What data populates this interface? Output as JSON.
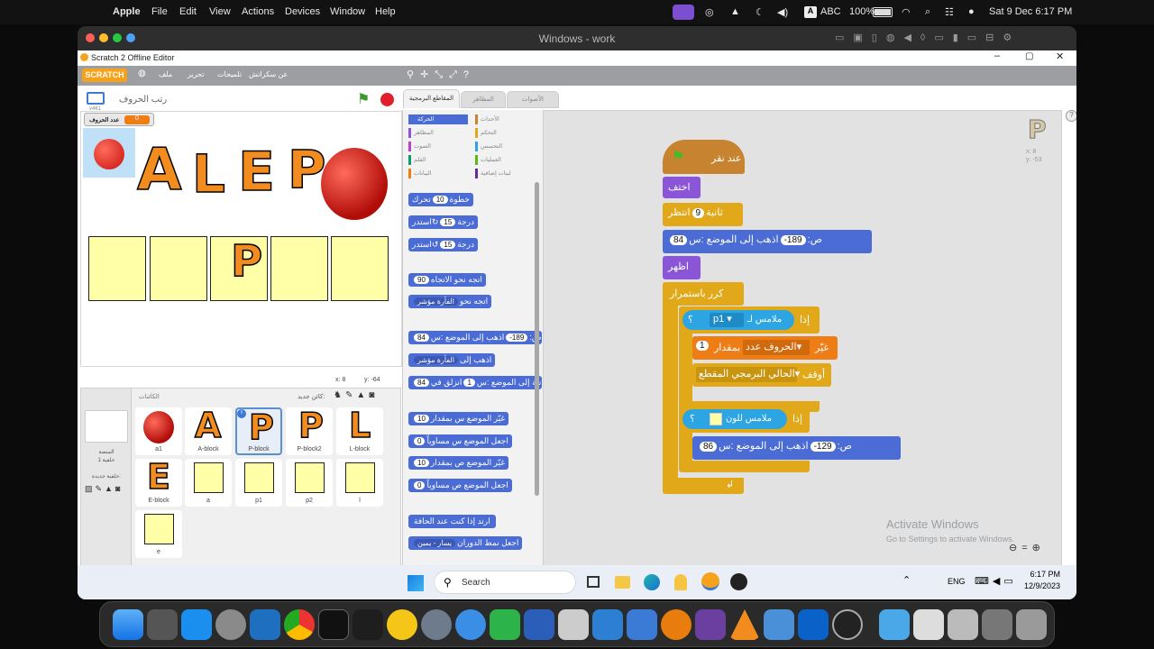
{
  "mac": {
    "app": "Apple",
    "menus": [
      "File",
      "Edit",
      "View",
      "Actions",
      "Devices",
      "Window",
      "Help"
    ],
    "kbd": "ABC",
    "battery": "100%",
    "datetime": "Sat 9 Dec  6:17 PM"
  },
  "vm": {
    "title": "Windows - work"
  },
  "scratch": {
    "title": "Scratch 2 Offline Editor",
    "logo": "SCRATCH",
    "menus": [
      "ملف",
      "تحرير",
      "تلميحات",
      "عن سكراتش"
    ],
    "stage": {
      "title": "رتب الحروف",
      "size": "v461",
      "var_label": "عدد الحروف",
      "var_value": "0",
      "coords_x": "x: 8",
      "coords_y": "y: -64",
      "letters": [
        "A",
        "L",
        "E",
        "P"
      ],
      "slot_letter": "P"
    },
    "tabs": [
      "المقاطع البرمجية",
      "المظاهر",
      "الأصوات"
    ],
    "categories_left": [
      "الحركة",
      "المظاهر",
      "الصوت",
      "القلم",
      "البيانات"
    ],
    "categories_right": [
      "الأحداث",
      "التحكم",
      "التحسس",
      "العمليات",
      "لبنات إضافية"
    ],
    "palette": [
      {
        "text": "تحرك",
        "val": "10",
        "text2": "خطوة"
      },
      {
        "text": "استدر",
        "val": "15",
        "text2": "درجة"
      },
      {
        "text": "استدر",
        "val": "15",
        "text2": "درجة"
      },
      {
        "text": "اتجه نحو الاتجاه",
        "val": "90"
      },
      {
        "text": "اتجه نحو",
        "text2": "الفأرة مؤشر"
      },
      {
        "text": "اذهب إلى الموضع :س",
        "val": "-189",
        "text2": "ص:",
        "val2": "84"
      },
      {
        "text": "اذهب إلى",
        "text2": "الفأرة مؤشر"
      },
      {
        "text": "انزلق في",
        "val": "1",
        "text2": "ثانية إلى الموضع :س",
        "val2": "84"
      },
      {
        "text": "غيّر الموضع س بمقدار",
        "val": "10"
      },
      {
        "text": "اجعل الموضع س مساوياً",
        "val": "0"
      },
      {
        "text": "غيّر الموضع ص بمقدار",
        "val": "10"
      },
      {
        "text": "اجعل الموضع ص مساوياً",
        "val": "0"
      },
      {
        "text": "ارتد إذا كنت عند الحافة"
      },
      {
        "text": "اجعل نمط الدوران",
        "text2": "يسار - يمين"
      }
    ],
    "sprites_label": "الكائنات",
    "new_sprite": "كائن جديد:",
    "stage_label": "المنصة",
    "stage_bg": "خلفية 1",
    "new_bg": "خلفية جديدة:",
    "sprite_names": [
      "a1",
      "A-block",
      "P-block",
      "P-block2",
      "L-block",
      "E-block",
      "a",
      "p1",
      "p2",
      "l",
      "e"
    ],
    "sprite_letters": [
      "",
      "A",
      "P",
      "P",
      "L",
      "E"
    ],
    "script": {
      "hat": "عند نقر",
      "hide": "اختف",
      "wait": "انتظر",
      "wait_val": "9",
      "wait_unit": "ثانية",
      "goto": "اذهب إلى الموضع :س",
      "goto_x": "-189",
      "goto_y_lbl": "ص:",
      "goto_y": "84",
      "show": "اظهر",
      "forever": "كرر باستمرار",
      "if1": "إذا",
      "touching": "ملامس لـ",
      "touch_target": "p1",
      "change": "غيّر",
      "change_var": "الحروف عدد",
      "change_by": "بمقدار",
      "change_val": "1",
      "stop": "أوقف",
      "stop_opt": "الحالي البرمجي المقطع",
      "if2": "إذا",
      "touch_color": "ملامس للون",
      "goto2": "اذهب إلى الموضع :س",
      "goto2_x": "-129",
      "goto2_y_lbl": "ص:",
      "goto2_y": "86",
      "qmark": "؟"
    },
    "sprite_info_x": "x: 8",
    "sprite_info_y": "y: -53",
    "activate_title": "Activate Windows",
    "activate_sub": "Go to Settings to activate Windows."
  },
  "taskbar": {
    "search": "Search",
    "lang": "ENG",
    "time": "6:17 PM",
    "date": "12/9/2023"
  },
  "colors": {
    "motion": "#4a6cd4",
    "looks": "#8a55d7",
    "events": "#c88330",
    "control": "#e1a91a",
    "sensing": "#2ca5e2",
    "data": "#ee7d16",
    "stage_bg": "#ffffff"
  }
}
